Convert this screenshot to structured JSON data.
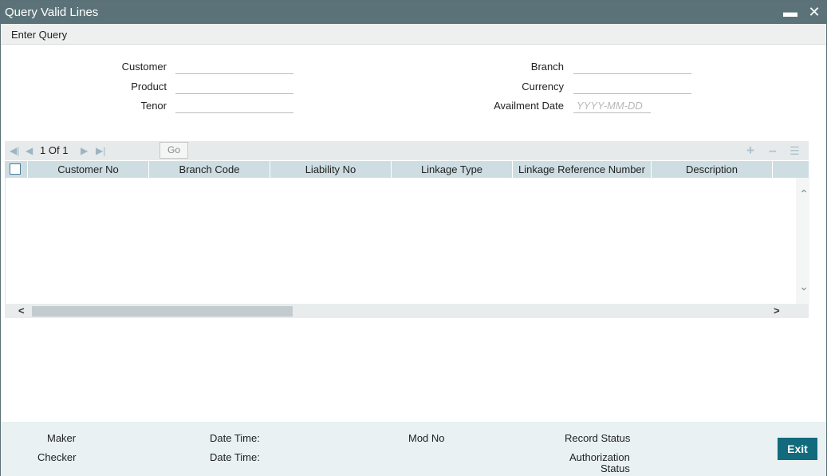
{
  "window": {
    "title": "Query Valid Lines"
  },
  "menu": {
    "enter_query": "Enter Query"
  },
  "form": {
    "customer": {
      "label": "Customer",
      "value": ""
    },
    "product": {
      "label": "Product",
      "value": ""
    },
    "tenor": {
      "label": "Tenor",
      "value": ""
    },
    "branch": {
      "label": "Branch",
      "value": ""
    },
    "currency": {
      "label": "Currency",
      "value": ""
    },
    "availment_date": {
      "label": "Availment Date",
      "placeholder": "YYYY-MM-DD",
      "value": ""
    }
  },
  "grid": {
    "pagination": {
      "current": "1",
      "of_label": "Of",
      "total": "1",
      "go_label": "Go"
    },
    "columns": [
      "Customer No",
      "Branch Code",
      "Liability No",
      "Linkage Type",
      "Linkage Reference Number",
      "Description"
    ],
    "rows": []
  },
  "footer": {
    "maker": "Maker",
    "checker": "Checker",
    "date_time_1": "Date Time:",
    "date_time_2": "Date Time:",
    "mod_no": "Mod No",
    "record_status": "Record Status",
    "authorization_status_line1": "Authorization",
    "authorization_status_line2": "Status",
    "exit_label": "Exit"
  },
  "icons": {
    "minimize": "minimize-icon",
    "close": "close-icon",
    "first": "first-page-icon",
    "prev": "previous-page-icon",
    "next": "next-page-icon",
    "last": "last-page-icon",
    "add_row": "plus-icon",
    "delete_row": "minus-icon",
    "column_settings": "list-icon"
  },
  "colors": {
    "titlebar": "#5b7378",
    "grid_header": "#cddde2",
    "footer": "#e9f1f2",
    "exit_button": "#126a7d"
  }
}
